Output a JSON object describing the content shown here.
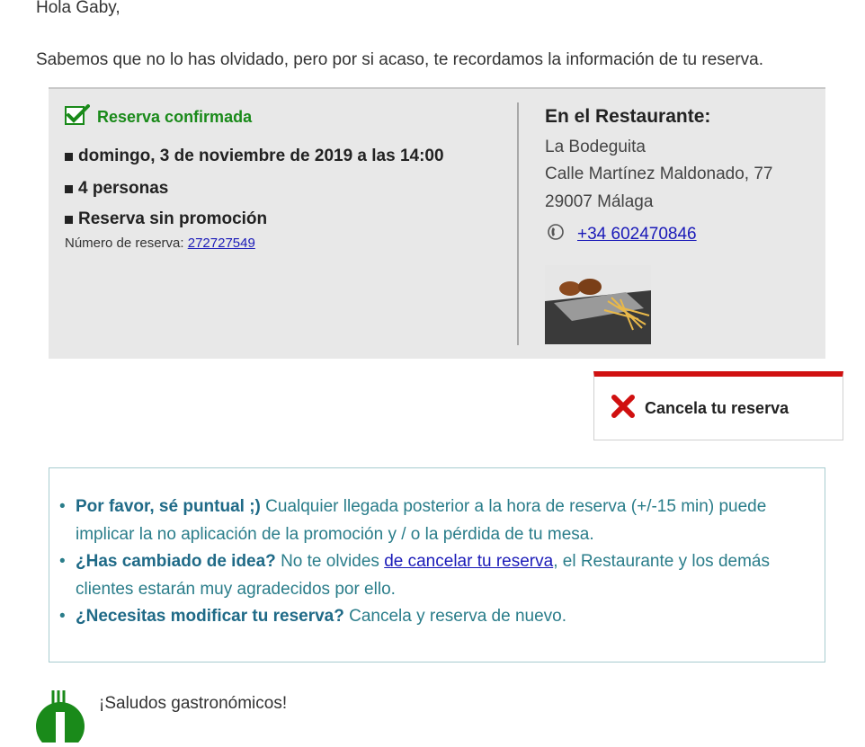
{
  "greeting": "Hola Gaby,",
  "intro": "Sabemos que no lo has olvidado, pero por si acaso, te recordamos la información de tu reserva.",
  "booking": {
    "status": "Reserva confirmada",
    "date_time": "domingo, 3 de noviembre de 2019 a las 14:00",
    "people": "4 personas",
    "promotion": "Reserva sin promoción",
    "number_label": "Número de reserva: ",
    "number": "272727549"
  },
  "restaurant": {
    "heading": "En el Restaurante:",
    "name": "La Bodeguita",
    "street": "Calle Martínez Maldonado, 77",
    "city": "29007 Málaga",
    "phone": "+34 602470846"
  },
  "cancel_button": "Cancela tu reserva",
  "tips": {
    "item1_bold": "Por favor, sé puntual ;)",
    "item1_text": " Cualquier llegada posterior a la hora de reserva (+/-15 min) puede implicar la no aplicación de la promoción y / o la pérdida de tu mesa.",
    "item2_bold": "¿Has cambiado de idea?",
    "item2_text_a": " No te olvides ",
    "item2_link": "de cancelar tu reserva",
    "item2_text_b": ", el Restaurante y los demás clientes estarán muy agradecidos por ello.",
    "item3_bold": "¿Necesitas modificar tu reserva?",
    "item3_text": " Cancela y reserva de nuevo."
  },
  "footer": {
    "greeting": "¡Saludos gastronómicos!"
  },
  "colors": {
    "confirmed_green": "#1a8a1a",
    "cancel_red": "#d01010",
    "tips_teal": "#2a7d8a",
    "link_blue": "#1a1ab8"
  }
}
